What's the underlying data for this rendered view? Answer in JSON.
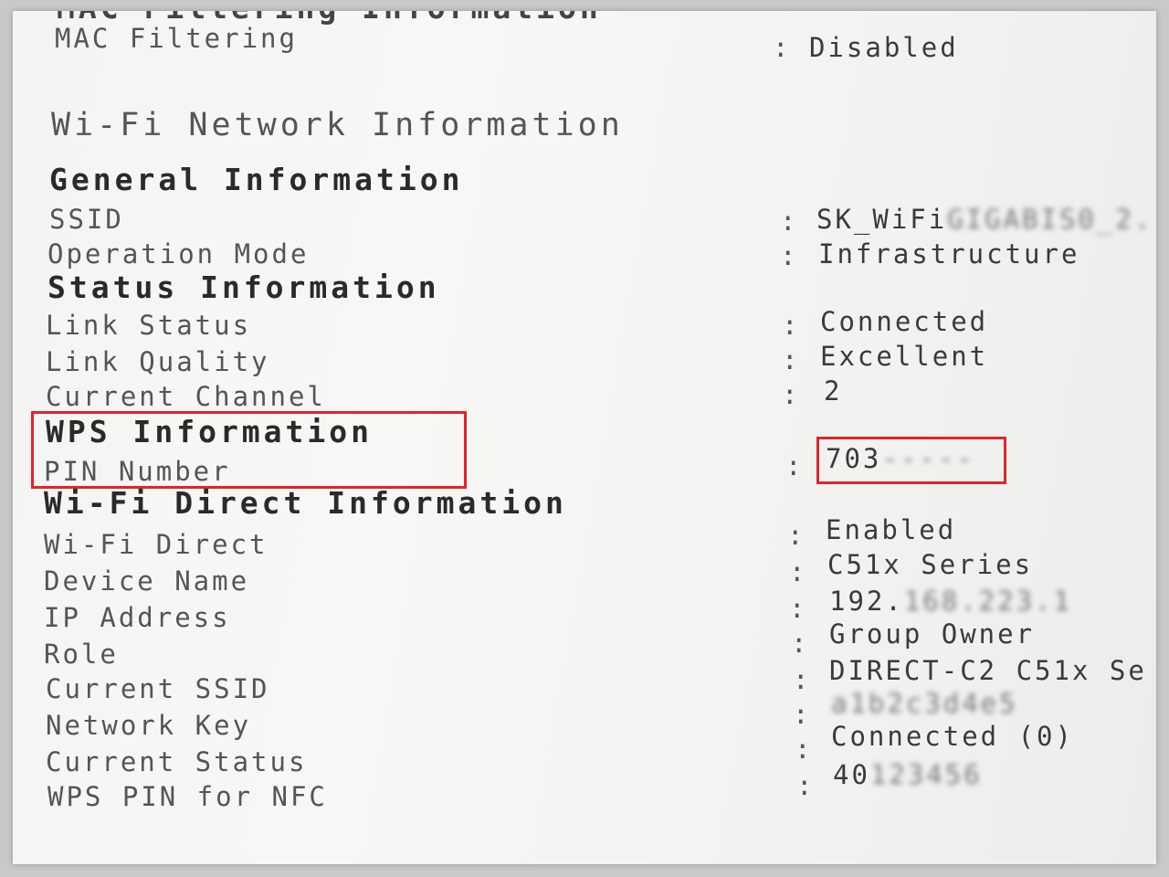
{
  "mac_filtering": {
    "title": "MAC Filtering Information",
    "label": "MAC Filtering",
    "value": "Disabled"
  },
  "wifi_title": "Wi-Fi Network Information",
  "general": {
    "title": "General Information",
    "ssid_label": "SSID",
    "ssid_value": "SK_WiFi",
    "ssid_value_masked": "GIGABIS0_2.",
    "mode_label": "Operation Mode",
    "mode_value": "Infrastructure"
  },
  "status": {
    "title": "Status Information",
    "link_status_label": "Link Status",
    "link_status_value": "Connected",
    "link_quality_label": "Link Quality",
    "link_quality_value": "Excellent",
    "channel_label": "Current Channel",
    "channel_value": "2"
  },
  "wps": {
    "title": "WPS Information",
    "pin_label": "PIN Number",
    "pin_value": "703",
    "pin_value_masked": "-----"
  },
  "direct": {
    "title": "Wi-Fi Direct Information",
    "direct_label": "Wi-Fi Direct",
    "direct_value": "Enabled",
    "device_label": "Device Name",
    "device_value": "C51x Series",
    "ip_label": "IP Address",
    "ip_value": "192.",
    "ip_value_masked": "168.223.1",
    "role_label": "Role",
    "role_value": "Group Owner",
    "ssid_label": "Current SSID",
    "ssid_value": "DIRECT-C2 C51x Se",
    "key_label": "Network Key",
    "key_value_masked": "a1b2c3d4e5",
    "current_status_label": "Current Status",
    "current_status_value": "Connected (0)",
    "nfc_label": "WPS PIN for NFC",
    "nfc_value": "40",
    "nfc_value_masked": "123456"
  },
  "separator": ":",
  "highlight_color": "#e0242a"
}
